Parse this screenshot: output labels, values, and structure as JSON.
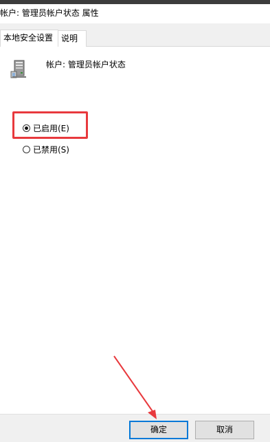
{
  "window": {
    "title": "帐户: 管理员帐户状态 属性"
  },
  "tabs": [
    {
      "label": "本地安全设置",
      "active": true
    },
    {
      "label": "说明",
      "active": false
    }
  ],
  "policy": {
    "name": "帐户: 管理员帐户状态",
    "icon": "server-policy-icon"
  },
  "options": [
    {
      "label": "已启用(E)",
      "selected": true
    },
    {
      "label": "已禁用(S)",
      "selected": false
    }
  ],
  "buttons": {
    "ok": "确定",
    "cancel": "取消"
  },
  "annotations": {
    "highlight_color": "#e8393d",
    "arrow_color": "#e8393d"
  }
}
